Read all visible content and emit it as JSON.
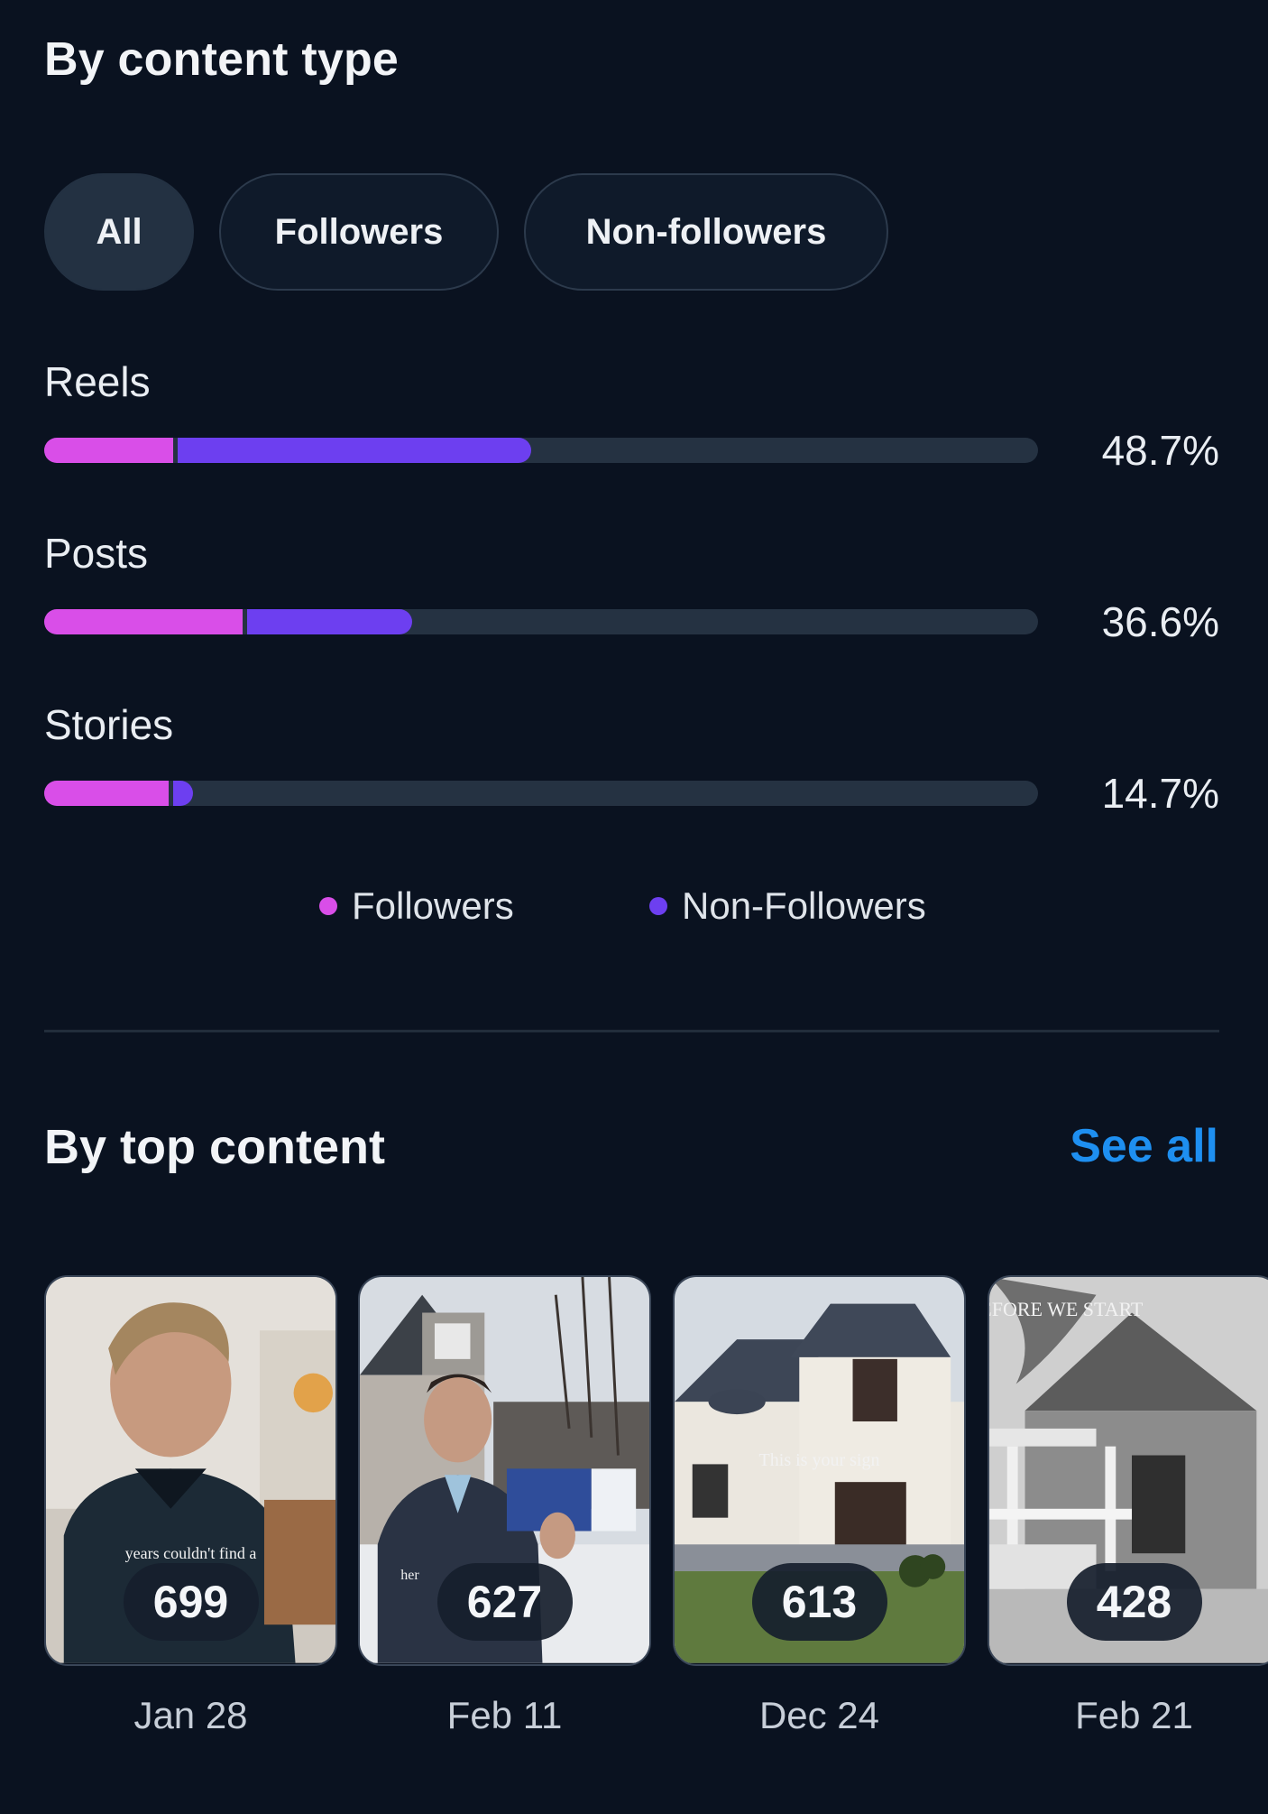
{
  "content_type": {
    "title": "By content type",
    "filters": [
      "All",
      "Followers",
      "Non-followers"
    ],
    "active_filter": "All",
    "rows": [
      {
        "label": "Reels",
        "percent_label": "48.7%",
        "followers_fraction": 0.13,
        "nonfollowers_fraction": 0.36
      },
      {
        "label": "Posts",
        "percent_label": "36.6%",
        "followers_fraction": 0.2,
        "nonfollowers_fraction": 0.17
      },
      {
        "label": "Stories",
        "percent_label": "14.7%",
        "followers_fraction": 0.125,
        "nonfollowers_fraction": 0.025
      }
    ],
    "legend": [
      {
        "label": "Followers",
        "color": "#d94ee8"
      },
      {
        "label": "Non-Followers",
        "color": "#6d3ff0"
      }
    ]
  },
  "top_content": {
    "title": "By top content",
    "see_all": "See all",
    "items": [
      {
        "count": "699",
        "date": "Jan 28",
        "caption": "years couldn't find a"
      },
      {
        "count": "627",
        "date": "Feb 11",
        "caption": "her"
      },
      {
        "count": "613",
        "date": "Dec 24",
        "caption": "This is your sign"
      },
      {
        "count": "428",
        "date": "Feb 21",
        "caption": "BEFORE WE START"
      }
    ]
  }
}
